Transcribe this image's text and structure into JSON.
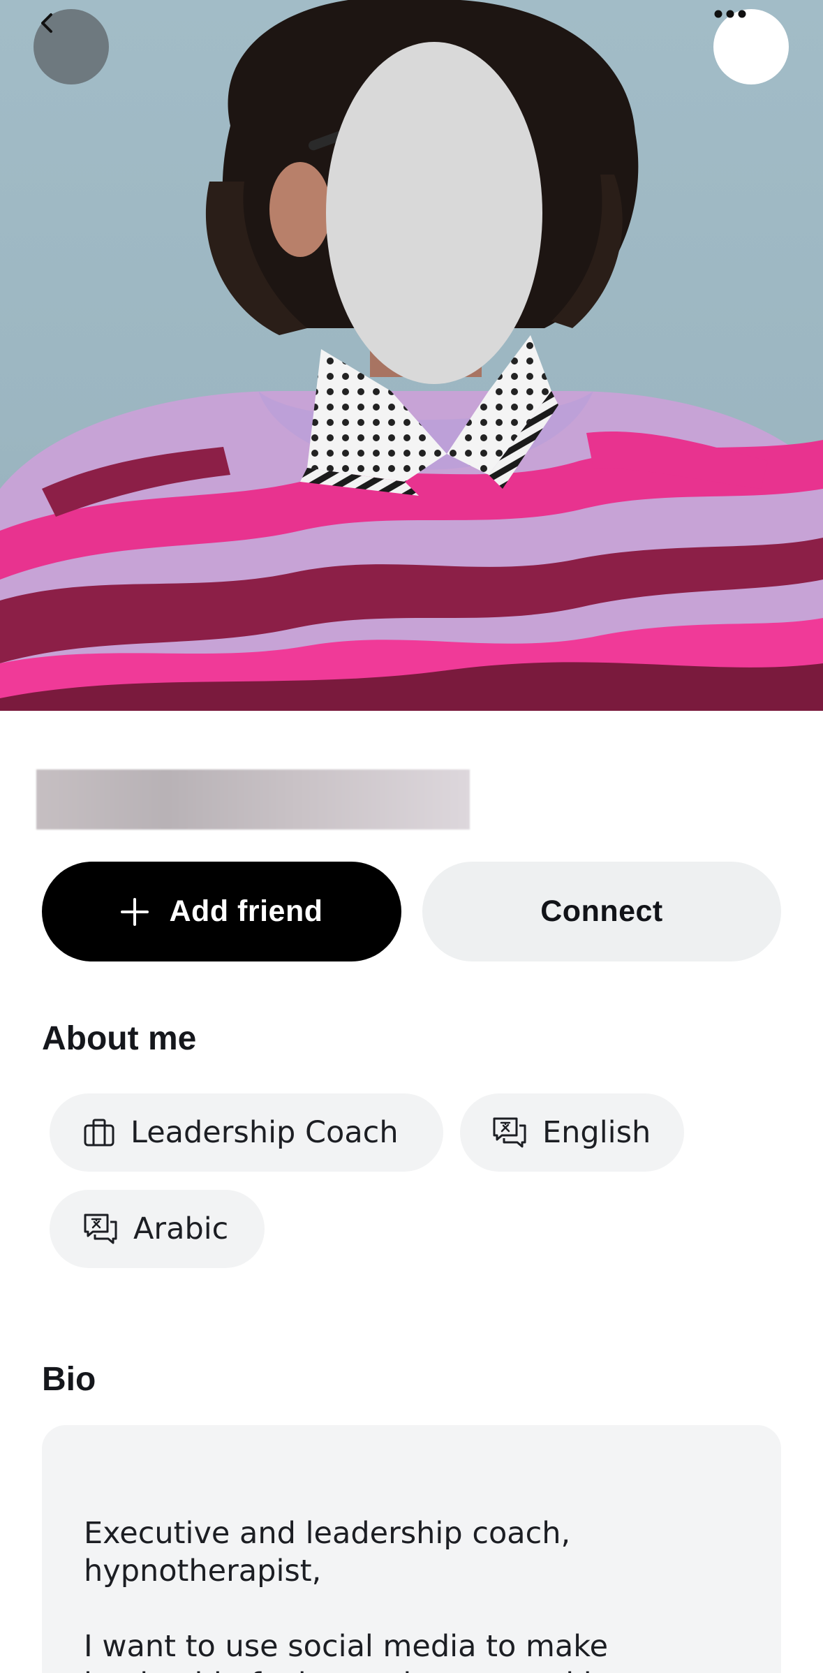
{
  "header": {
    "back_icon": "chevron-left-icon",
    "more_icon": "more-horizontal-icon"
  },
  "actions": {
    "add_friend_label": "Add friend",
    "add_friend_icon": "plus-icon",
    "connect_label": "Connect"
  },
  "about": {
    "title": "About me",
    "chips": [
      {
        "label": "Leadership Coach",
        "icon": "briefcase-icon"
      },
      {
        "label": "English",
        "icon": "translate-icon"
      },
      {
        "label": "Arabic",
        "icon": "translate-icon"
      }
    ]
  },
  "bio": {
    "title": "Bio",
    "text": "Executive and leadership coach,\nhypnotherapist,\n\nI want to use social media to make\nleadership feel more human and less"
  },
  "colors": {
    "primary_button_bg": "#000000",
    "secondary_button_bg": "#eef0f1",
    "chip_bg": "#f2f3f4",
    "card_bg": "#f3f4f5"
  }
}
